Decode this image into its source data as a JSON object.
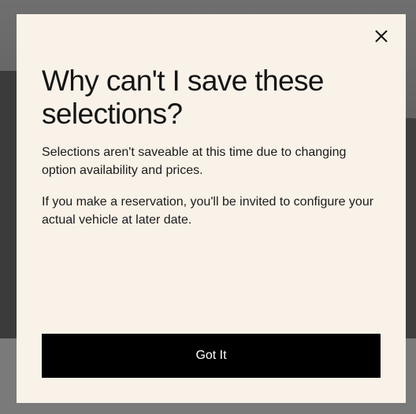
{
  "modal": {
    "title": "Why can't I save these selections?",
    "paragraphs": [
      "Selections aren't saveable at this time due to changing option availability and prices.",
      "If you make a reservation, you'll be invited to configure your actual vehicle at later date."
    ],
    "primary_button_label": "Got It",
    "close_icon": "close-icon"
  },
  "colors": {
    "modal_background": "#f9f2e8",
    "button_background": "#000000",
    "button_text": "#ffffff",
    "text": "#141414"
  }
}
